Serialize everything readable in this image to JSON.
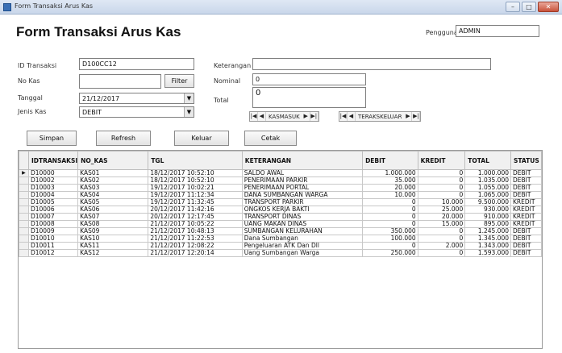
{
  "window": {
    "title": "Form Transaksi Arus Kas"
  },
  "form": {
    "heading": "Form Transaksi Arus Kas",
    "user_label": "Pengguna",
    "user_value": "ADMIN",
    "fields": {
      "id_label": "ID Transaksi",
      "id_value": "D100CC12",
      "kas_label": "No Kas",
      "kas_value": "",
      "filter_label": "Filter",
      "tanggal_label": "Tanggal",
      "tanggal_value": "21/12/2017",
      "jenis_label": "Jenis Kas",
      "jenis_value": "DEBIT",
      "keterangan_label": "Keterangan",
      "keterangan_value": "",
      "nominal_label": "Nominal",
      "nominal_value": "0",
      "total_label": "Total",
      "total_value": "0"
    },
    "nav1": {
      "caption": "KASMASUK"
    },
    "nav2": {
      "caption": "TERAKSKELUAR"
    },
    "buttons": {
      "simpan": "Simpan",
      "refresh": "Refresh",
      "keluar": "Keluar",
      "cetak": "Cetak"
    }
  },
  "table": {
    "columns": [
      "IDTRANSAKSI",
      "NO_KAS",
      "TGL",
      "KETERANGAN",
      "DEBIT",
      "KREDIT",
      "TOTAL",
      "STATUS"
    ],
    "rows": [
      [
        "D10000",
        "KAS01",
        "18/12/2017 10:52:10",
        "SALDO AWAL",
        "1.000.000",
        "0",
        "1.000.000",
        "DEBIT"
      ],
      [
        "D10002",
        "KAS02",
        "18/12/2017 10:52:10",
        "PENERIMAAN PARKIR",
        "35.000",
        "0",
        "1.035.000",
        "DEBIT"
      ],
      [
        "D10003",
        "KAS03",
        "19/12/2017 10:02:21",
        "PENERIMAAN PORTAL",
        "20.000",
        "0",
        "1.055.000",
        "DEBIT"
      ],
      [
        "D10004",
        "KAS04",
        "19/12/2017 11:12:34",
        "DANA SUMBANGAN WARGA",
        "10.000",
        "0",
        "1.065.000",
        "DEBIT"
      ],
      [
        "D10005",
        "KAS05",
        "19/12/2017 11:32:45",
        "TRANSPORT PARKIR",
        "0",
        "10.000",
        "9.500.000",
        "KREDIT"
      ],
      [
        "D10006",
        "KAS06",
        "20/12/2017 11:42:16",
        "ONGKOS KERJA BAKTI",
        "0",
        "25.000",
        "930.000",
        "KREDIT"
      ],
      [
        "D10007",
        "KAS07",
        "20/12/2017 12:17:45",
        "TRANSPORT DINAS",
        "0",
        "20.000",
        "910.000",
        "KREDIT"
      ],
      [
        "D10008",
        "KAS08",
        "21/12/2017 10:05:22",
        "UANG MAKAN DINAS",
        "0",
        "15.000",
        "895.000",
        "KREDIT"
      ],
      [
        "D10009",
        "KAS09",
        "21/12/2017 10:48:13",
        "SUMBANGAN KELURAHAN",
        "350.000",
        "0",
        "1.245.000",
        "DEBIT"
      ],
      [
        "D10010",
        "KAS10",
        "21/12/2017 11:22:53",
        "Dana Sumbangan",
        "100.000",
        "0",
        "1.345.000",
        "DEBIT"
      ],
      [
        "D10011",
        "KAS11",
        "21/12/2017 12:08:22",
        "Pengeluaran ATK Dan Dll",
        "0",
        "2.000",
        "1.343.000",
        "DEBIT"
      ],
      [
        "D10012",
        "KAS12",
        "21/12/2017 12:20:14",
        "Uang Sumbangan Warga",
        "250.000",
        "0",
        "1.593.000",
        "DEBIT"
      ]
    ]
  },
  "colors": {
    "accent": "#3a6fb5",
    "close": "#c8523b"
  }
}
